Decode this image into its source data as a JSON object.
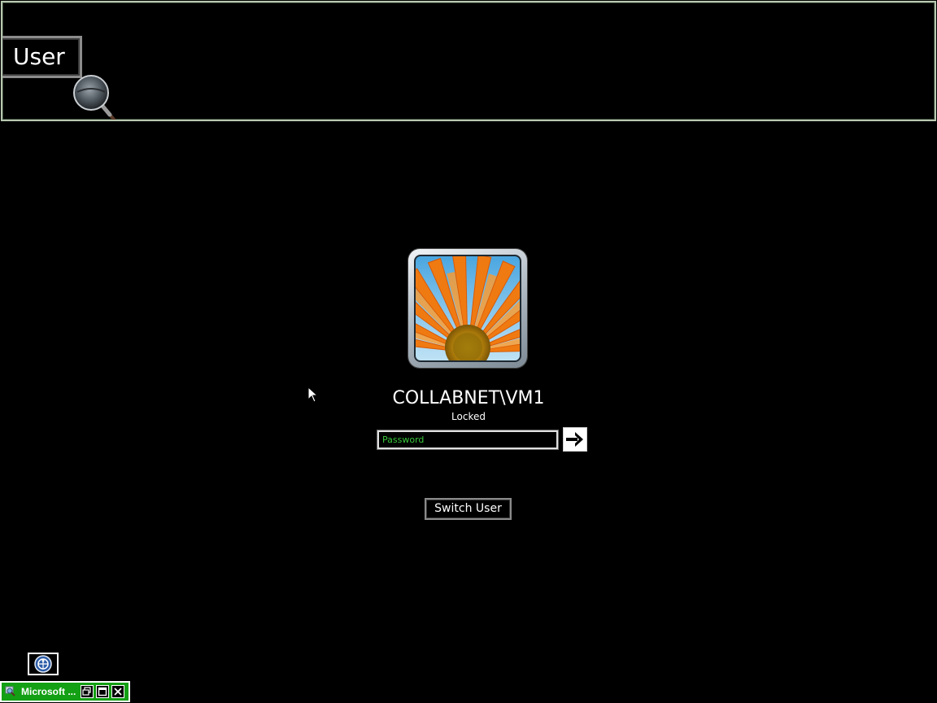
{
  "magnifier": {
    "zoomed_button_label": "User",
    "icon": "magnifying-glass-icon"
  },
  "logon": {
    "username": "COLLABNET\\VM1",
    "status": "Locked",
    "password_placeholder": "Password",
    "password_value": "",
    "submit_icon": "arrow-right-icon",
    "switch_user_label": "Switch User",
    "avatar_picture": "orange-gerbera-daisy"
  },
  "ease_of_access": {
    "icon": "ease-of-access-icon"
  },
  "minimized_window": {
    "title": "Microsoft ...",
    "icon": "magnifier-app-icon",
    "controls": [
      "restore-icon",
      "maximize-icon",
      "close-icon"
    ]
  },
  "colors": {
    "background": "#000000",
    "accent_green": "#14a014",
    "placeholder_green": "#39c83a",
    "text": "#ffffff"
  }
}
